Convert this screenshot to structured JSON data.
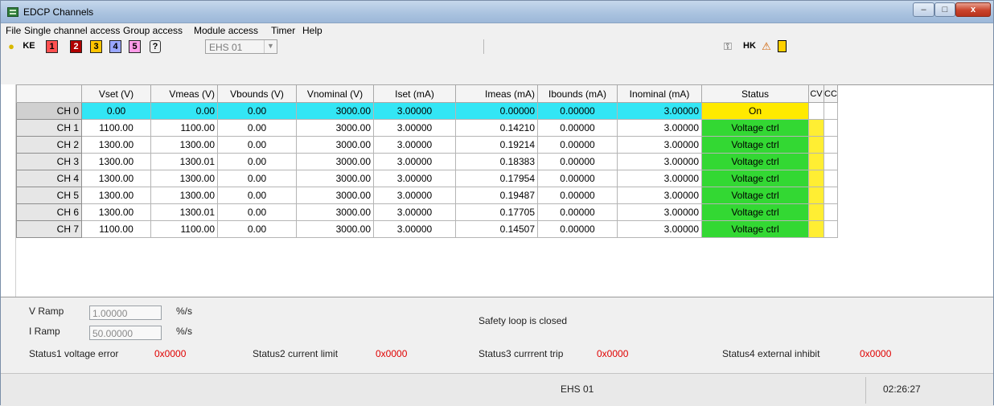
{
  "window": {
    "title": "EDCP Channels",
    "controls": [
      "–",
      "□",
      "x"
    ]
  },
  "menu": [
    "File",
    "Single channel access",
    "Group access",
    "Module access",
    "Timer",
    "Help"
  ],
  "toolbar": {
    "left_buttons": [
      "KE",
      "1",
      "2",
      "3",
      "4",
      "5"
    ],
    "module_combo": "EHS 01",
    "right_buttons": [
      "HK"
    ]
  },
  "table": {
    "columns": [
      "",
      "Vset (V)",
      "Vmeas (V)",
      "Vbounds (V)",
      "Vnominal (V)",
      "Iset (mA)",
      "Imeas (mA)",
      "Ibounds (mA)",
      "Inominal (mA)",
      "Status",
      "CV",
      "CC"
    ],
    "rows": [
      [
        "CH 0",
        "0.00",
        "0.00",
        "0.00",
        "3000.00",
        "3.00000",
        "0.00000",
        "0.00000",
        "3.00000",
        "On"
      ],
      [
        "CH 1",
        "1100.00",
        "1100.00",
        "0.00",
        "3000.00",
        "3.00000",
        "0.14210",
        "0.00000",
        "3.00000",
        "Voltage ctrl"
      ],
      [
        "CH 2",
        "1300.00",
        "1300.00",
        "0.00",
        "3000.00",
        "3.00000",
        "0.19214",
        "0.00000",
        "3.00000",
        "Voltage ctrl"
      ],
      [
        "CH 3",
        "1300.00",
        "1300.01",
        "0.00",
        "3000.00",
        "3.00000",
        "0.18383",
        "0.00000",
        "3.00000",
        "Voltage ctrl"
      ],
      [
        "CH 4",
        "1300.00",
        "1300.00",
        "0.00",
        "3000.00",
        "3.00000",
        "0.17954",
        "0.00000",
        "3.00000",
        "Voltage ctrl"
      ],
      [
        "CH 5",
        "1300.00",
        "1300.00",
        "0.00",
        "3000.00",
        "3.00000",
        "0.19487",
        "0.00000",
        "3.00000",
        "Voltage ctrl"
      ],
      [
        "CH 6",
        "1300.00",
        "1300.01",
        "0.00",
        "3000.00",
        "3.00000",
        "0.17705",
        "0.00000",
        "3.00000",
        "Voltage ctrl"
      ],
      [
        "CH 7",
        "1100.00",
        "1100.00",
        "0.00",
        "3000.00",
        "3.00000",
        "0.14507",
        "0.00000",
        "3.00000",
        "Voltage ctrl"
      ]
    ],
    "selected_row": "CH 0",
    "colors": {
      "selected": "#33e6f5",
      "status_on": "#ffea00",
      "status_voltage_ctrl": "#33d833",
      "cv_flag": "#ffee33"
    }
  },
  "ramp": {
    "v_label": "V Ramp",
    "v_value": "1.00000",
    "v_unit": "%/s",
    "i_label": "I Ramp",
    "i_value": "50.00000",
    "i_unit": "%/s"
  },
  "safety": "Safety loop is closed",
  "status_flags": [
    {
      "label": "Status1 voltage error",
      "value": "0x0000"
    },
    {
      "label": "Status2 current limit",
      "value": "0x0000"
    },
    {
      "label": "Status3 currrent trip",
      "value": "0x0000"
    },
    {
      "label": "Status4 external inhibit",
      "value": "0x0000"
    }
  ],
  "statusbar": {
    "module": "EHS 01",
    "time": "02:26:27"
  }
}
